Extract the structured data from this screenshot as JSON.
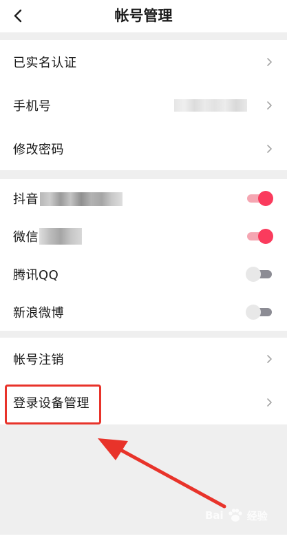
{
  "header": {
    "title": "帐号管理",
    "back_icon": "chevron-left-icon"
  },
  "account_section": {
    "items": [
      {
        "label": "已实名认证"
      },
      {
        "label": "手机号"
      },
      {
        "label": "修改密码"
      }
    ]
  },
  "bindings_section": {
    "items": [
      {
        "label": "抖音",
        "enabled": true
      },
      {
        "label": "微信",
        "enabled": true
      },
      {
        "label": "腾讯QQ",
        "enabled": false
      },
      {
        "label": "新浪微博",
        "enabled": false
      }
    ]
  },
  "manage_section": {
    "items": [
      {
        "label": "帐号注销"
      },
      {
        "label": "登录设备管理"
      }
    ]
  },
  "colors": {
    "toggle_on": "#fa3b5d",
    "toggle_off": "#8c8c94",
    "highlight": "#e8332a",
    "background": "#efefef"
  },
  "watermark": {
    "brand_mark": "Bai",
    "icon": "paw-icon",
    "suffix": "经验"
  }
}
